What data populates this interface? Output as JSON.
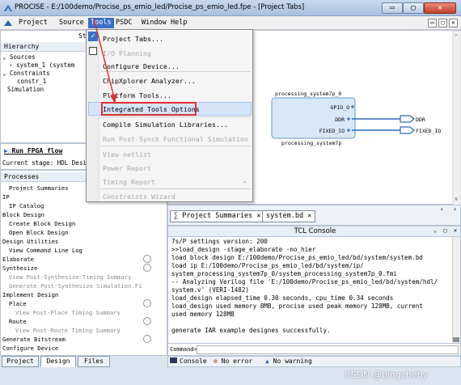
{
  "window": {
    "title": "PROCISE - E:/100demo/Procise_ps_emio_led/Procise_ps_emio_led.fpe - [Project Tabs]",
    "buttons": {
      "minimize": "▭",
      "maximize": "▢",
      "close": "✕"
    }
  },
  "menubar": {
    "items": [
      "Project",
      "Source",
      "Tools",
      "PSDC",
      "Window",
      "Help"
    ],
    "active": "Tools",
    "mdi": [
      "▭",
      "▢",
      "✕"
    ]
  },
  "hierarchy": {
    "panel_label": "Hierarchy",
    "partial_header": "St",
    "lines": [
      "Sources",
      "system_1 (system",
      "Constraints",
      "constr_1",
      "Simulation"
    ]
  },
  "run": {
    "label": "Run FPGA flow",
    "stage": "Current stage: HDL Design"
  },
  "processes": {
    "header": "Processes",
    "items": [
      {
        "text": "Project Summaries",
        "level": 1,
        "disabled": false
      },
      {
        "text": "IP",
        "level": 0,
        "disabled": false
      },
      {
        "text": "IP Catalog",
        "level": 1,
        "disabled": false
      },
      {
        "text": "Block Design",
        "level": 0,
        "disabled": false
      },
      {
        "text": "Create Block Design",
        "level": 1,
        "disabled": false
      },
      {
        "text": "Open Block Design",
        "level": 1,
        "disabled": false
      },
      {
        "text": "Design Utilities",
        "level": 0,
        "disabled": false
      },
      {
        "text": "View Command Line Log",
        "level": 1,
        "disabled": false
      },
      {
        "text": "Elaborate",
        "level": 0,
        "disabled": false
      },
      {
        "text": "Synthesize",
        "level": 0,
        "disabled": false
      },
      {
        "text": "View Post-Synthesize Timing Summary",
        "level": 1,
        "disabled": true
      },
      {
        "text": "Generate Post-Synthesize Simulation.Fi",
        "level": 1,
        "disabled": true
      },
      {
        "text": "Implement Design",
        "level": 0,
        "disabled": false
      },
      {
        "text": "Place",
        "level": 1,
        "disabled": false
      },
      {
        "text": "View Post-Place Timing Summary",
        "level": 2,
        "disabled": true
      },
      {
        "text": "Route",
        "level": 1,
        "disabled": false
      },
      {
        "text": "View Post-Route Timing Summary",
        "level": 2,
        "disabled": true
      },
      {
        "text": "Generate Bitstream",
        "level": 0,
        "disabled": false
      },
      {
        "text": "Configure Device",
        "level": 0,
        "disabled": false
      }
    ]
  },
  "left_tabs": [
    "Project",
    "Design",
    "Files"
  ],
  "tools_menu": {
    "items": [
      {
        "label": "Project Tabs...",
        "disabled": false,
        "checked": true
      },
      {
        "label": "I/O Planning",
        "disabled": true,
        "checked": false
      },
      {
        "label": "Configure Device...",
        "disabled": false
      },
      {
        "label": "ChipXplorer Analyzer...",
        "disabled": false
      },
      {
        "label": "Platform Tools...",
        "disabled": false
      },
      {
        "label": "Integrated Tools Options",
        "disabled": false,
        "highlighted": true
      },
      {
        "label": "Compile Simulation Libraries...",
        "disabled": false
      },
      {
        "label": "Run Post-Synch Functional Simulation",
        "disabled": true
      },
      {
        "label": "View netlist",
        "disabled": true
      },
      {
        "label": "Power Report",
        "disabled": true
      },
      {
        "label": "Timing Report",
        "disabled": true,
        "submenu": true
      },
      {
        "label": "Constraints Wizard",
        "disabled": true
      }
    ]
  },
  "block": {
    "top_label": "processing_system7p_0",
    "bottom_label": "processing_system7p",
    "pins": [
      "GPIO_O",
      "DDR",
      "FIXED_IO"
    ],
    "ports": [
      "DDR",
      "FIXED_IO"
    ]
  },
  "doc_tabs": [
    "Project Summaries",
    "system.bd"
  ],
  "console": {
    "title": "TCL Console",
    "lines": [
      "7s/P settings version: 200",
      ">>load_design -stage_elaborate -no_hier",
      "  load block design E:/100demo/Procise_ps_emio_led/bd/system/system.bd",
      "  load ip E:/100demo/Procise_ps_emio_led/bd/system/ip/",
      "system_processing_system7p_0/system_processing_system7p_0.fmi",
      "  -- Analyzing Verilog file 'E:/100demo/Procise_ps_emio_led/bd/system/hdl/",
      "system.v' (VERI-1482)",
      "  load_design elapsed_time 0.30 seconds, cpu_time 0.34 seconds",
      "  load_design used memory 8MB, procise used peak memory 128MB, current",
      "used memory 128MB",
      "",
      "generate IAR example designes successfully."
    ],
    "command_label": "Command>",
    "status_tabs": [
      "Console",
      "No error",
      "No warning"
    ]
  },
  "watermark": "CSDN @bingcheby",
  "colors": {
    "highlight_border": "#e03030",
    "selection": "#3a6fc8",
    "pin_blue": "#2a6ab8"
  }
}
